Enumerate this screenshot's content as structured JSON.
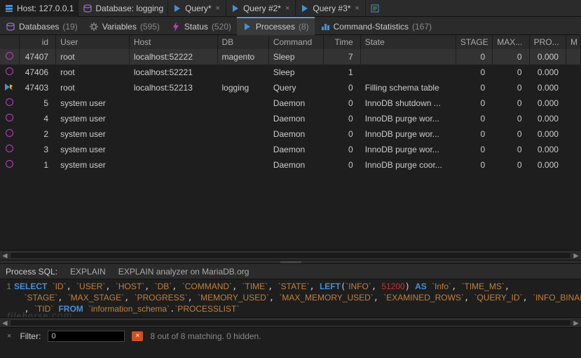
{
  "top_tabs": {
    "host": "Host: 127.0.0.1",
    "database": "Database: logging",
    "queries": [
      "Query*",
      "Query #2*",
      "Query #3*"
    ]
  },
  "sub_tabs": {
    "databases": {
      "label": "Databases",
      "count": "(19)"
    },
    "variables": {
      "label": "Variables",
      "count": "(595)"
    },
    "status": {
      "label": "Status",
      "count": "(520)"
    },
    "processes": {
      "label": "Processes",
      "count": "(8)"
    },
    "cmdstats": {
      "label": "Command-Statistics",
      "count": "(167)"
    }
  },
  "columns": {
    "id": "id",
    "user": "User",
    "host": "Host",
    "db": "DB",
    "command": "Command",
    "time": "Time",
    "state": "State",
    "stage": "STAGE",
    "max": "MAX...",
    "pro": "PRO...",
    "m": "M"
  },
  "rows": [
    {
      "cur": false,
      "id": "47407",
      "user": "root",
      "host": "localhost:52222",
      "db": "magento",
      "cmd": "Sleep",
      "time": "7",
      "state": "",
      "stage": "0",
      "max": "0",
      "pro": "0.000",
      "sel": true
    },
    {
      "cur": false,
      "id": "47406",
      "user": "root",
      "host": "localhost:52221",
      "db": "",
      "cmd": "Sleep",
      "time": "1",
      "state": "",
      "stage": "0",
      "max": "0",
      "pro": "0.000",
      "sel": false
    },
    {
      "cur": true,
      "id": "47403",
      "user": "root",
      "host": "localhost:52213",
      "db": "logging",
      "cmd": "Query",
      "time": "0",
      "state": "Filling schema table",
      "stage": "0",
      "max": "0",
      "pro": "0.000",
      "sel": false
    },
    {
      "cur": false,
      "id": "5",
      "user": "system user",
      "host": "",
      "db": "",
      "cmd": "Daemon",
      "time": "0",
      "state": "InnoDB shutdown ...",
      "stage": "0",
      "max": "0",
      "pro": "0.000",
      "sel": false
    },
    {
      "cur": false,
      "id": "4",
      "user": "system user",
      "host": "",
      "db": "",
      "cmd": "Daemon",
      "time": "0",
      "state": "InnoDB purge wor...",
      "stage": "0",
      "max": "0",
      "pro": "0.000",
      "sel": false
    },
    {
      "cur": false,
      "id": "2",
      "user": "system user",
      "host": "",
      "db": "",
      "cmd": "Daemon",
      "time": "0",
      "state": "InnoDB purge wor...",
      "stage": "0",
      "max": "0",
      "pro": "0.000",
      "sel": false
    },
    {
      "cur": false,
      "id": "3",
      "user": "system user",
      "host": "",
      "db": "",
      "cmd": "Daemon",
      "time": "0",
      "state": "InnoDB purge wor...",
      "stage": "0",
      "max": "0",
      "pro": "0.000",
      "sel": false
    },
    {
      "cur": false,
      "id": "1",
      "user": "system user",
      "host": "",
      "db": "",
      "cmd": "Daemon",
      "time": "0",
      "state": "InnoDB purge coor...",
      "stage": "0",
      "max": "0",
      "pro": "0.000",
      "sel": false
    }
  ],
  "sql_header": {
    "title": "Process SQL:",
    "explain": "EXPLAIN",
    "analyzer": "EXPLAIN analyzer on MariaDB.org"
  },
  "sql": {
    "kw_select": "SELECT",
    "kw_left": "LEFT",
    "kw_as": "AS",
    "kw_from": "FROM",
    "num": "51200",
    "c": {
      "id": "`ID`",
      "user": "`USER`",
      "host": "`HOST`",
      "db": "`DB`",
      "command": "`COMMAND`",
      "time": "`TIME`",
      "state": "`STATE`",
      "info": "`INFO`",
      "info2": "`Info`",
      "time_ms": "`TIME_MS`",
      "stage": "`STAGE`",
      "max_stage": "`MAX_STAGE`",
      "progress": "`PROGRESS`",
      "memory_used": "`MEMORY_USED`",
      "max_memory_used": "`MAX_MEMORY_USED`",
      "examined_rows": "`EXAMINED_ROWS`",
      "query_id": "`QUERY_ID`",
      "info_binary": "`INFO_BINARY`",
      "tid": "`TID`",
      "schema": "`information_schema`",
      "table": "`PROCESSLIST`"
    }
  },
  "filter": {
    "label": "Filter:",
    "value": "0",
    "status": "8 out of 8 matching. 0 hidden."
  },
  "watermark": {
    "name": "filehorse",
    "dom": ".com"
  }
}
